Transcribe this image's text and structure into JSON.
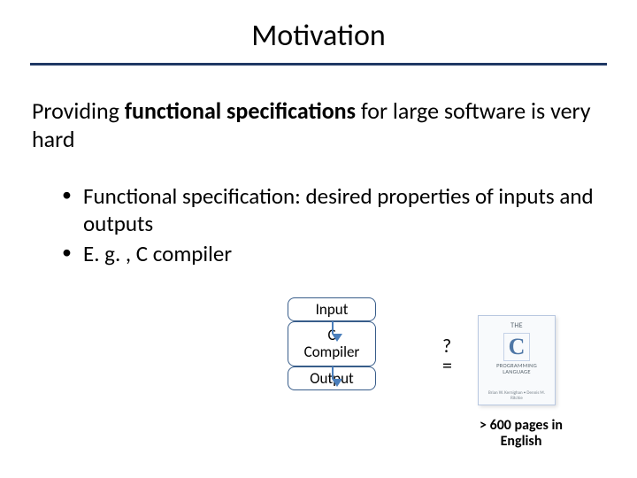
{
  "title": "Motivation",
  "lead_pre": "Providing ",
  "lead_bold": "functional specifications",
  "lead_post": " for large software is very hard",
  "bullets": [
    "Functional specification: desired properties of inputs and outputs",
    "E. g. , C compiler"
  ],
  "diagram": {
    "input": "Input",
    "mid1": "C",
    "mid2": "Compiler",
    "output": "Output"
  },
  "qeq_line1": "?",
  "qeq_line2": "=",
  "book": {
    "top": "THE",
    "big": "C",
    "sub": "PROGRAMMING\nLANGUAGE",
    "foot": "Brian W. Kernighan • Dennis M. Ritchie"
  },
  "caption": "> 600 pages in English"
}
